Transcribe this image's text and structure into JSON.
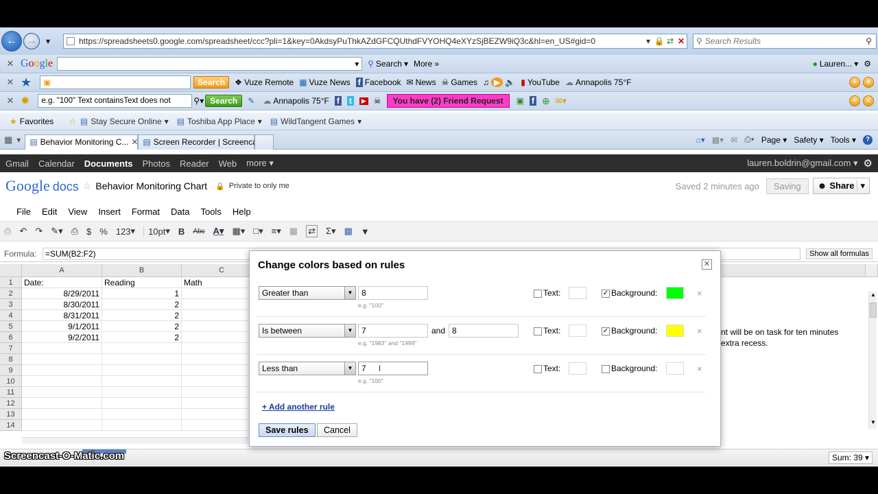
{
  "browser": {
    "url": "https://spreadsheets0.google.com/spreadsheet/ccc?pli=1&key=0AkdsyPuThkAZdGFCQUthdFVYOHQ4eXYzSjBEZW9iQ3c&hl=en_US#gid=0",
    "search_placeholder": "Search Results",
    "google_bar": {
      "search_label": "Search",
      "more_label": "More",
      "user_label": "Lauren..."
    },
    "toolbar2": {
      "search_label": "Search",
      "items": [
        "Vuze Remote",
        "Vuze News",
        "Facebook",
        "News",
        "Games",
        "YouTube",
        "Annapolis 75°F"
      ]
    },
    "toolbar3": {
      "query_value": "e.g. \"100\" Text containsText does not",
      "search_label": "Search",
      "weather": "Annapolis 75°F",
      "friend_request": "You have (2) Friend Request"
    },
    "favorites": {
      "label": "Favorites",
      "items": [
        "Stay Secure Online",
        "Toshiba App Place",
        "WildTangent Games"
      ]
    },
    "tabs": [
      "Behavior Monitoring C...",
      "Screen Recorder | Screenca..."
    ],
    "commands": [
      "Page",
      "Safety",
      "Tools"
    ]
  },
  "gbar": {
    "links": [
      "Gmail",
      "Calendar",
      "Documents",
      "Photos",
      "Reader",
      "Web",
      "more"
    ],
    "active": "Documents",
    "email": "lauren.boldrin@gmail.com"
  },
  "docs": {
    "logo_google": "Google",
    "logo_docs": "docs",
    "title": "Behavior Monitoring Chart",
    "privacy": "Private to only me",
    "saved_status": "Saved 2 minutes ago",
    "saving_label": "Saving",
    "share_label": "Share"
  },
  "menu": [
    "File",
    "Edit",
    "View",
    "Insert",
    "Format",
    "Data",
    "Tools",
    "Help"
  ],
  "toolbar": {
    "currency": "$",
    "percent": "%",
    "number_format": "123",
    "font_size": "10pt",
    "bold": "B",
    "strike": "Abc"
  },
  "formula": {
    "label": "Formula:",
    "value": "=SUM(B2:F2)",
    "show_all": "Show all formulas"
  },
  "sheet": {
    "columns": [
      "A",
      "B",
      "C"
    ],
    "row_numbers": [
      "1",
      "2",
      "3",
      "4",
      "5",
      "6",
      "7",
      "8",
      "9",
      "10",
      "11",
      "12",
      "13",
      "14"
    ],
    "header": [
      "Date:",
      "Reading",
      "Math"
    ],
    "rows": [
      [
        "8/29/2011",
        "1"
      ],
      [
        "8/30/2011",
        "2"
      ],
      [
        "8/31/2011",
        "2"
      ],
      [
        "9/1/2011",
        "2"
      ],
      [
        "9/2/2011",
        "2"
      ]
    ],
    "note_line1": "nt will be on task for ten minutes",
    "note_line2": "extra recess."
  },
  "dialog": {
    "title": "Change colors based on rules",
    "rules": [
      {
        "condition": "Greater than",
        "value": "8",
        "hint": "e.g. \"100\"",
        "text_checked": false,
        "bg_checked": true,
        "bg_color": "#00ff00"
      },
      {
        "condition": "Is between",
        "value": "7",
        "value2": "8",
        "and_label": "and",
        "hint": "e.g. \"1983\" and \"1999\"",
        "text_checked": false,
        "bg_checked": true,
        "bg_color": "#ffff00"
      },
      {
        "condition": "Less than",
        "value": "7",
        "hint": "e.g. \"100\"",
        "text_checked": false,
        "bg_checked": false,
        "bg_color": "#ffffff"
      }
    ],
    "text_label": "Text:",
    "background_label": "Background:",
    "add_rule": "+ Add another rule",
    "save_label": "Save rules",
    "cancel_label": "Cancel"
  },
  "status": {
    "sum": "Sum: 39"
  },
  "watermark": "Screencast-O-Matic.com"
}
